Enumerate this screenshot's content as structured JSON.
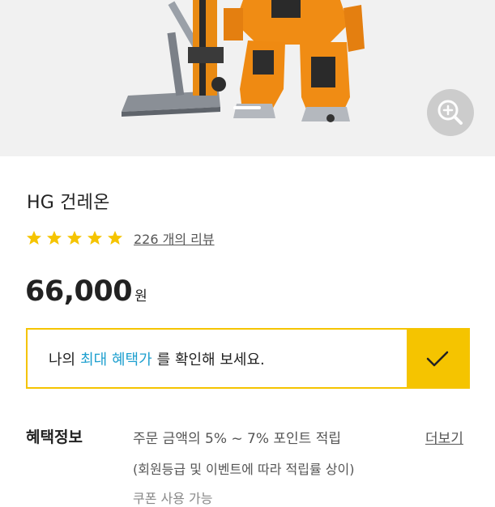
{
  "product": {
    "title": "HG 건레온",
    "review_count_text": "226 개의 리뷰",
    "stars": 5,
    "price": "66,000",
    "price_unit": "원"
  },
  "benefit_banner": {
    "prefix": "나의",
    "highlight": "최대 혜택가",
    "suffix": "를 확인해 보세요.",
    "accent_color": "#f5c400",
    "highlight_color": "#1d9fcf",
    "check_icon": "check-icon"
  },
  "benefit_info": {
    "label": "혜택정보",
    "line1": "주문 금액의 5% ~ 7% 포인트 적립",
    "line2": "(회원등급 및 이벤트에 따라 적립률 상이)",
    "line3": "쿠폰 사용 가능",
    "more_label": "더보기"
  },
  "icons": {
    "zoom": "zoom-in-icon",
    "star": "star-icon"
  },
  "colors": {
    "star": "#f5c400",
    "hero_bg": "#f1f1f1"
  }
}
